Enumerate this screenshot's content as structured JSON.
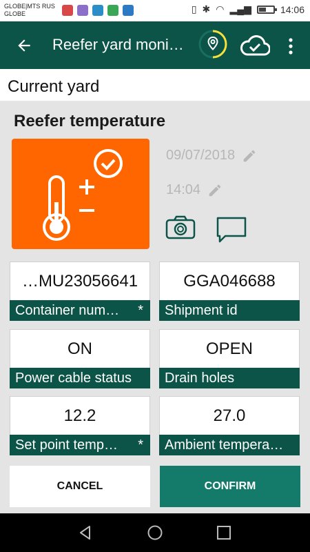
{
  "statusbar": {
    "carrier_line1": "GLOBE|MTS RUS",
    "carrier_line2": "GLOBE",
    "time": "14:06"
  },
  "toolbar": {
    "title": "Reefer yard moni…"
  },
  "yard": {
    "label": "Current yard"
  },
  "section": {
    "title": "Reefer temperature",
    "date": "09/07/2018",
    "time": "14:04"
  },
  "fields": [
    {
      "value": "…MU23056641",
      "label": "Container num…",
      "required": "*"
    },
    {
      "value": "GGA046688",
      "label": "Shipment id",
      "required": ""
    },
    {
      "value": "ON",
      "label": "Power cable status",
      "required": ""
    },
    {
      "value": "OPEN",
      "label": "Drain holes",
      "required": ""
    },
    {
      "value": "12.2",
      "label": "Set point temp…",
      "required": "*"
    },
    {
      "value": "27.0",
      "label": "Ambient tempera…",
      "required": ""
    }
  ],
  "buttons": {
    "cancel": "CANCEL",
    "confirm": "CONFIRM"
  },
  "colors": {
    "toolbar": "#0c5448",
    "accent": "#ff6600",
    "confirm": "#147a6a",
    "location_ring": "#f4e13a"
  },
  "icons": {
    "back": "arrow-back-icon",
    "location": "location-pin-icon",
    "cloud": "cloud-check-icon",
    "more": "more-vert-icon",
    "thermometer": "thermometer-icon",
    "camera": "camera-icon",
    "comment": "comment-icon",
    "pencil": "pencil-icon"
  }
}
